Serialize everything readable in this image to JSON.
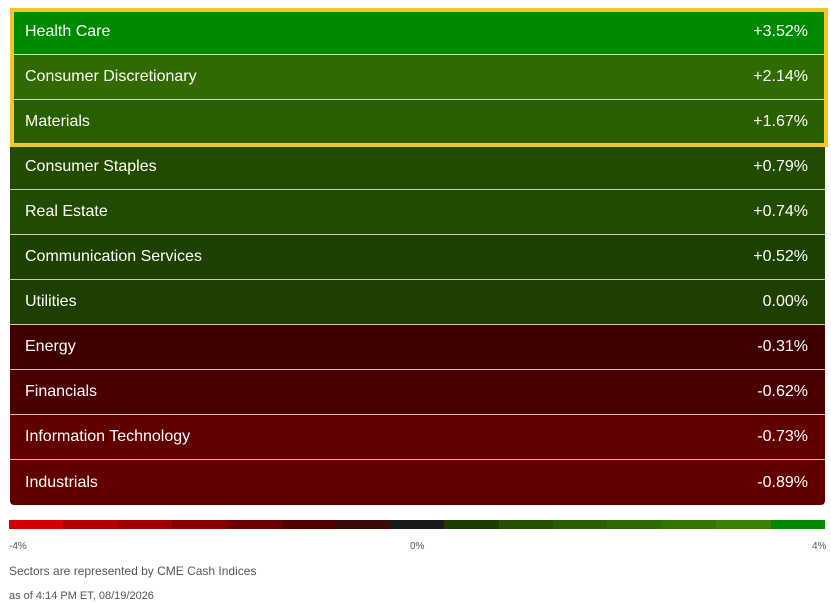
{
  "sectors": [
    {
      "name": "Health Care",
      "change": "+3.52%",
      "color": "#008a00"
    },
    {
      "name": "Consumer Discretionary",
      "change": "+2.14%",
      "color": "#2f6b00"
    },
    {
      "name": "Materials",
      "change": "+1.67%",
      "color": "#2a5f00"
    },
    {
      "name": "Consumer Staples",
      "change": "+0.79%",
      "color": "#224b00"
    },
    {
      "name": "Real Estate",
      "change": "+0.74%",
      "color": "#224a00"
    },
    {
      "name": "Communication Services",
      "change": "+0.52%",
      "color": "#1e4000"
    },
    {
      "name": "Utilities",
      "change": "0.00%",
      "color": "#1e3f00"
    },
    {
      "name": "Energy",
      "change": "-0.31%",
      "color": "#400000"
    },
    {
      "name": "Financials",
      "change": "-0.62%",
      "color": "#4a0000"
    },
    {
      "name": "Information Technology",
      "change": "-0.73%",
      "color": "#620000"
    },
    {
      "name": "Industrials",
      "change": "-0.89%",
      "color": "#620000"
    }
  ],
  "highlight_color": "#f3c623",
  "scale": {
    "min_label": "-4%",
    "mid_label": "0%",
    "max_label": "4%",
    "colors": [
      "#d40000",
      "#b80000",
      "#a00000",
      "#870000",
      "#6e0000",
      "#550000",
      "#3d0a0a",
      "#1b1b1b",
      "#1f3d00",
      "#245000",
      "#2a5f00",
      "#2f6b00",
      "#347700",
      "#3a8200",
      "#008a00"
    ]
  },
  "footer": {
    "note": "Sectors are represented by CME Cash Indices",
    "timestamp": "as of 4:14 PM ET, 08/19/2026"
  }
}
